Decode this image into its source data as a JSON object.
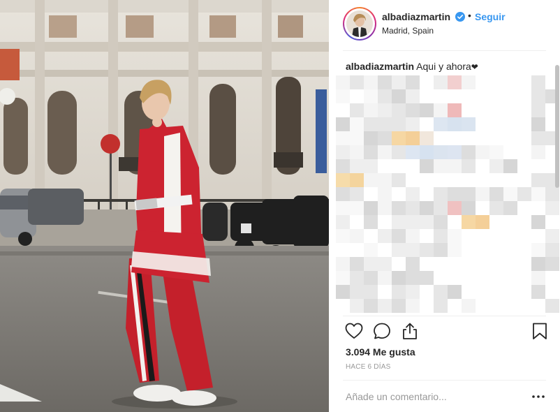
{
  "post": {
    "username": "albadiazmartin",
    "follow_label": "Seguir",
    "separator": "•",
    "location": "Madrid, Spain"
  },
  "caption": {
    "username": "albadiazmartin",
    "text": "Aqui y ahora",
    "emoji": "❤"
  },
  "actions": {
    "icons": [
      "heart-icon",
      "comment-icon",
      "share-icon",
      "bookmark-icon"
    ]
  },
  "stats": {
    "likes": "3.094 Me gusta",
    "time": "HACE 6 DÍAS"
  },
  "comment_box": {
    "placeholder": "Añade un comentario..."
  },
  "colors": {
    "link": "#3897f0",
    "verified": "#3897f0",
    "text": "#262626",
    "muted": "#999999",
    "divider": "#efefef"
  }
}
